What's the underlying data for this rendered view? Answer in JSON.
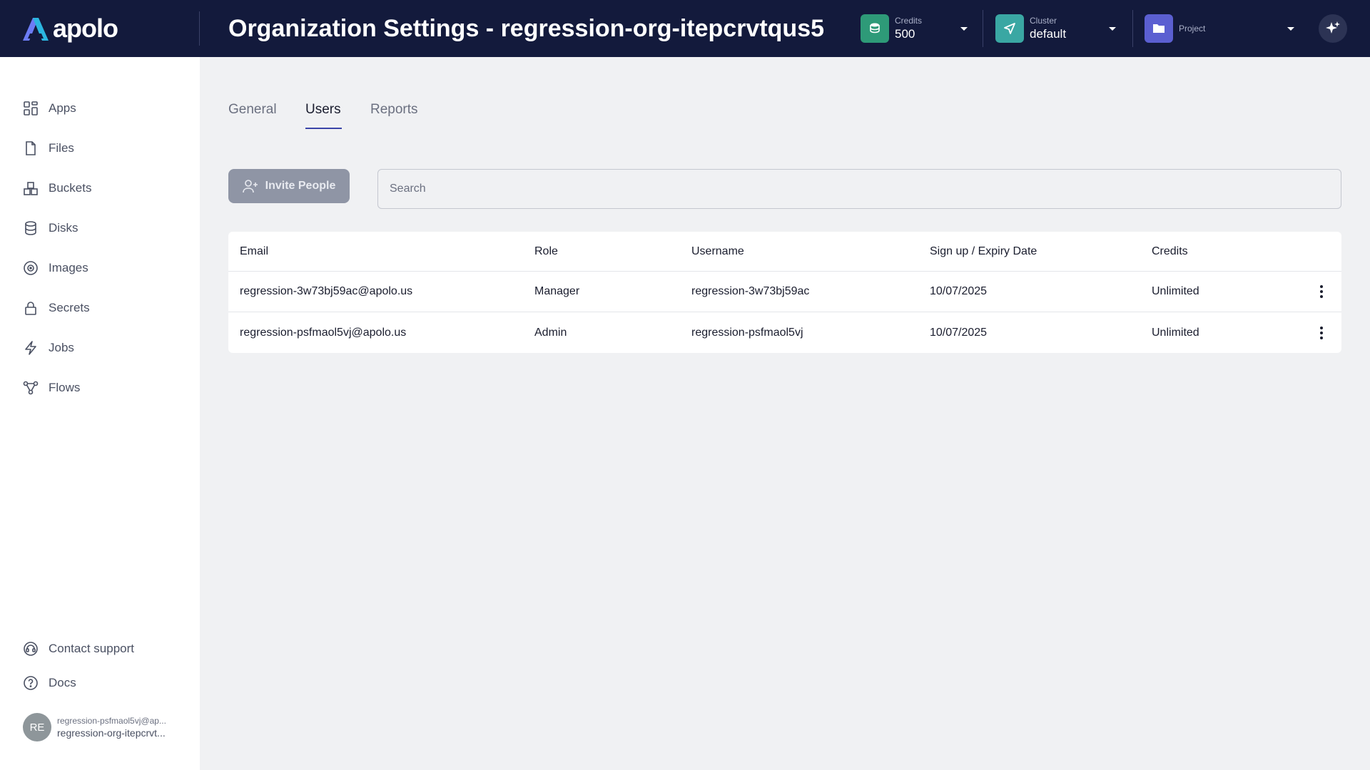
{
  "header": {
    "logo_text": "apolo",
    "title": "Organization Settings - regression-org-itepcrvtqus5",
    "credits": {
      "label": "Credits",
      "value": "500",
      "color": "#2e9a78"
    },
    "cluster": {
      "label": "Cluster",
      "value": "default",
      "color": "#3aa7a3"
    },
    "project": {
      "label": "Project",
      "color": "#5b5fd1"
    }
  },
  "sidebar": {
    "items": [
      {
        "label": "Apps",
        "icon": "apps-icon"
      },
      {
        "label": "Files",
        "icon": "file-icon"
      },
      {
        "label": "Buckets",
        "icon": "buckets-icon"
      },
      {
        "label": "Disks",
        "icon": "disk-icon"
      },
      {
        "label": "Images",
        "icon": "image-icon"
      },
      {
        "label": "Secrets",
        "icon": "lock-icon"
      },
      {
        "label": "Jobs",
        "icon": "lightning-icon"
      },
      {
        "label": "Flows",
        "icon": "flows-icon"
      }
    ],
    "footer": [
      {
        "label": "Contact support",
        "icon": "headset-icon"
      },
      {
        "label": "Docs",
        "icon": "help-icon"
      }
    ],
    "user": {
      "initials": "RE",
      "email": "regression-psfmaol5vj@ap...",
      "org": "regression-org-itepcrvt..."
    }
  },
  "tabs": [
    {
      "label": "General",
      "active": false
    },
    {
      "label": "Users",
      "active": true
    },
    {
      "label": "Reports",
      "active": false
    }
  ],
  "toolbar": {
    "invite_label": "Invite People",
    "search_placeholder": "Search",
    "search_value": ""
  },
  "table": {
    "columns": [
      "Email",
      "Role",
      "Username",
      "Sign up / Expiry Date",
      "Credits"
    ],
    "rows": [
      {
        "email": "regression-3w73bj59ac@apolo.us",
        "role": "Manager",
        "username": "regression-3w73bj59ac",
        "date": "10/07/2025",
        "credits": "Unlimited"
      },
      {
        "email": "regression-psfmaol5vj@apolo.us",
        "role": "Admin",
        "username": "regression-psfmaol5vj",
        "date": "10/07/2025",
        "credits": "Unlimited"
      }
    ]
  }
}
